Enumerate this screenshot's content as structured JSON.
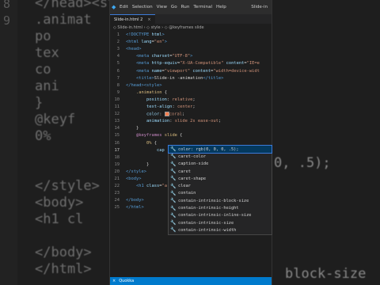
{
  "background": {
    "lines": [
      {
        "num": "8",
        "text": "</head><st"
      },
      {
        "num": "9",
        "text": "  .animat"
      },
      {
        "num": "",
        "text": "      po"
      },
      {
        "num": "",
        "text": "      tex"
      },
      {
        "num": "",
        "text": "      co"
      },
      {
        "num": "",
        "text": "      ani"
      },
      {
        "num": "",
        "text": "  }"
      },
      {
        "num": "",
        "text": "  @keyf"
      },
      {
        "num": "",
        "text": "    0%"
      },
      {
        "num": "",
        "text": ""
      },
      {
        "num": "",
        "text": ""
      },
      {
        "num": "",
        "text": "</style>"
      },
      {
        "num": "",
        "text": "<body>"
      },
      {
        "num": "",
        "text": "  <h1 cl"
      },
      {
        "num": "",
        "text": ""
      },
      {
        "num": "",
        "text": "</body>"
      },
      {
        "num": "",
        "text": "</html>"
      }
    ],
    "right_fragments": [
      "0, .5);",
      "block-size"
    ]
  },
  "menubar": {
    "items": [
      "Edit",
      "Selection",
      "View",
      "Go",
      "Run",
      "Terminal",
      "Help"
    ],
    "window_title": "Slide-in"
  },
  "tab": {
    "label": "Slide-in.html 2",
    "close": "×"
  },
  "breadcrumb": "◇ Slide-in.html › ◇ style › ◇ @keyframes slide",
  "code_lines": [
    {
      "n": "1",
      "html": "<span class='tag'>&lt;!DOCTYPE</span> <span class='attr'>html</span><span class='tag'>&gt;</span>"
    },
    {
      "n": "2",
      "html": "<span class='tag'>&lt;html</span> <span class='attr'>lang</span>=<span class='str'>\"en\"</span><span class='tag'>&gt;</span>"
    },
    {
      "n": "3",
      "html": "<span class='tag'>&lt;head&gt;</span>"
    },
    {
      "n": "4",
      "html": "    <span class='tag'>&lt;meta</span> <span class='attr'>charset</span>=<span class='str'>\"UTF-8\"</span><span class='tag'>&gt;</span>"
    },
    {
      "n": "5",
      "html": "    <span class='tag'>&lt;meta</span> <span class='attr'>http-equiv</span>=<span class='str'>\"X-UA-Compatible\"</span> <span class='attr'>content</span>=<span class='str'>\"IE=e</span>"
    },
    {
      "n": "6",
      "html": "    <span class='tag'>&lt;meta</span> <span class='attr'>name</span>=<span class='str'>\"viewport\"</span> <span class='attr'>content</span>=<span class='str'>\"width=device-widt</span>"
    },
    {
      "n": "7",
      "html": "    <span class='tag'>&lt;title&gt;</span>Slide-in -animation<span class='tag'>&lt;/title&gt;</span>"
    },
    {
      "n": "8",
      "html": "<span class='tag'>&lt;/head&gt;&lt;style&gt;</span>"
    },
    {
      "n": "9",
      "html": "    <span class='sel'>.animation</span> {"
    },
    {
      "n": "10",
      "html": "        <span class='prop'>position</span>: <span class='val'>relative</span>;"
    },
    {
      "n": "11",
      "html": "        <span class='prop'>text-align</span>: <span class='val'>center</span>;"
    },
    {
      "n": "12",
      "html": "        <span class='prop'>color</span>: <span class='swatch'></span><span class='val'>coral</span>;"
    },
    {
      "n": "13",
      "html": "        <span class='prop'>animation</span>: <span class='val'>slide 2s ease-out</span>;"
    },
    {
      "n": "14",
      "html": "    }"
    },
    {
      "n": "15",
      "html": "    <span class='kw'>@keyframes</span> <span class='sel'>slide</span> {"
    },
    {
      "n": "16",
      "html": "        <span class='sel'>0%</span> {"
    },
    {
      "n": "17",
      "html": "            <span class='prop'>cap</span>"
    },
    {
      "n": "18",
      "html": ""
    },
    {
      "n": "19",
      "html": "        }"
    },
    {
      "n": "20",
      "html": "<span class='tag'>&lt;/style&gt;</span>"
    },
    {
      "n": "21",
      "html": "<span class='tag'>&lt;body&gt;</span>"
    },
    {
      "n": "22",
      "html": "    <span class='tag'>&lt;h1</span> <span class='attr'>class</span>=<span class='str'>\"a</span>"
    },
    {
      "n": "23",
      "html": ""
    },
    {
      "n": "24",
      "html": "<span class='tag'>&lt;/body&gt;</span>"
    },
    {
      "n": "25",
      "html": "<span class='tag'>&lt;/html&gt;</span>"
    }
  ],
  "current_line": "17",
  "suggestions": [
    "color: rgb(0, 0, 0, .5);",
    "caret-color",
    "caption-side",
    "caret",
    "caret-shape",
    "clear",
    "contain",
    "contain-intrinsic-block-size",
    "contain-intrinsic-height",
    "contain-intrinsic-inline-size",
    "contain-intrinsic-size",
    "contain-intrinsic-width"
  ],
  "suggestion_icon": "wrench-icon",
  "status": {
    "close": "×",
    "label": "Quokka"
  },
  "colors": {
    "accent": "#007acc",
    "editor_bg": "#1e1e1e",
    "popup_select": "#04395e"
  }
}
